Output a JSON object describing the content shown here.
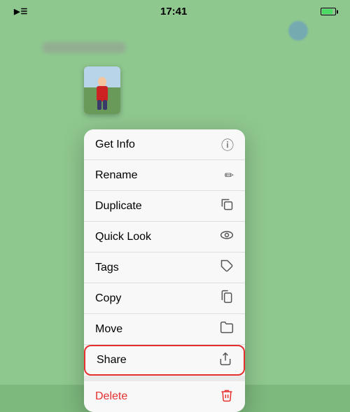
{
  "statusBar": {
    "time": "17:41",
    "signal": "▲▲▲",
    "wifi": "wifi"
  },
  "contextMenu": {
    "items": [
      {
        "id": "get-info",
        "label": "Get Info",
        "icon": "info",
        "highlighted": false,
        "delete": false
      },
      {
        "id": "rename",
        "label": "Rename",
        "icon": "rename",
        "highlighted": false,
        "delete": false
      },
      {
        "id": "duplicate",
        "label": "Duplicate",
        "icon": "duplicate",
        "highlighted": false,
        "delete": false
      },
      {
        "id": "quick-look",
        "label": "Quick Look",
        "icon": "quicklook",
        "highlighted": false,
        "delete": false
      },
      {
        "id": "tags",
        "label": "Tags",
        "icon": "tags",
        "highlighted": false,
        "delete": false
      },
      {
        "id": "copy",
        "label": "Copy",
        "icon": "copy",
        "highlighted": false,
        "delete": false
      },
      {
        "id": "move",
        "label": "Move",
        "icon": "move",
        "highlighted": false,
        "delete": false
      },
      {
        "id": "share",
        "label": "Share",
        "icon": "share",
        "highlighted": true,
        "delete": false
      }
    ],
    "deleteItem": {
      "id": "delete",
      "label": "Delete",
      "icon": "delete",
      "delete": true
    }
  }
}
